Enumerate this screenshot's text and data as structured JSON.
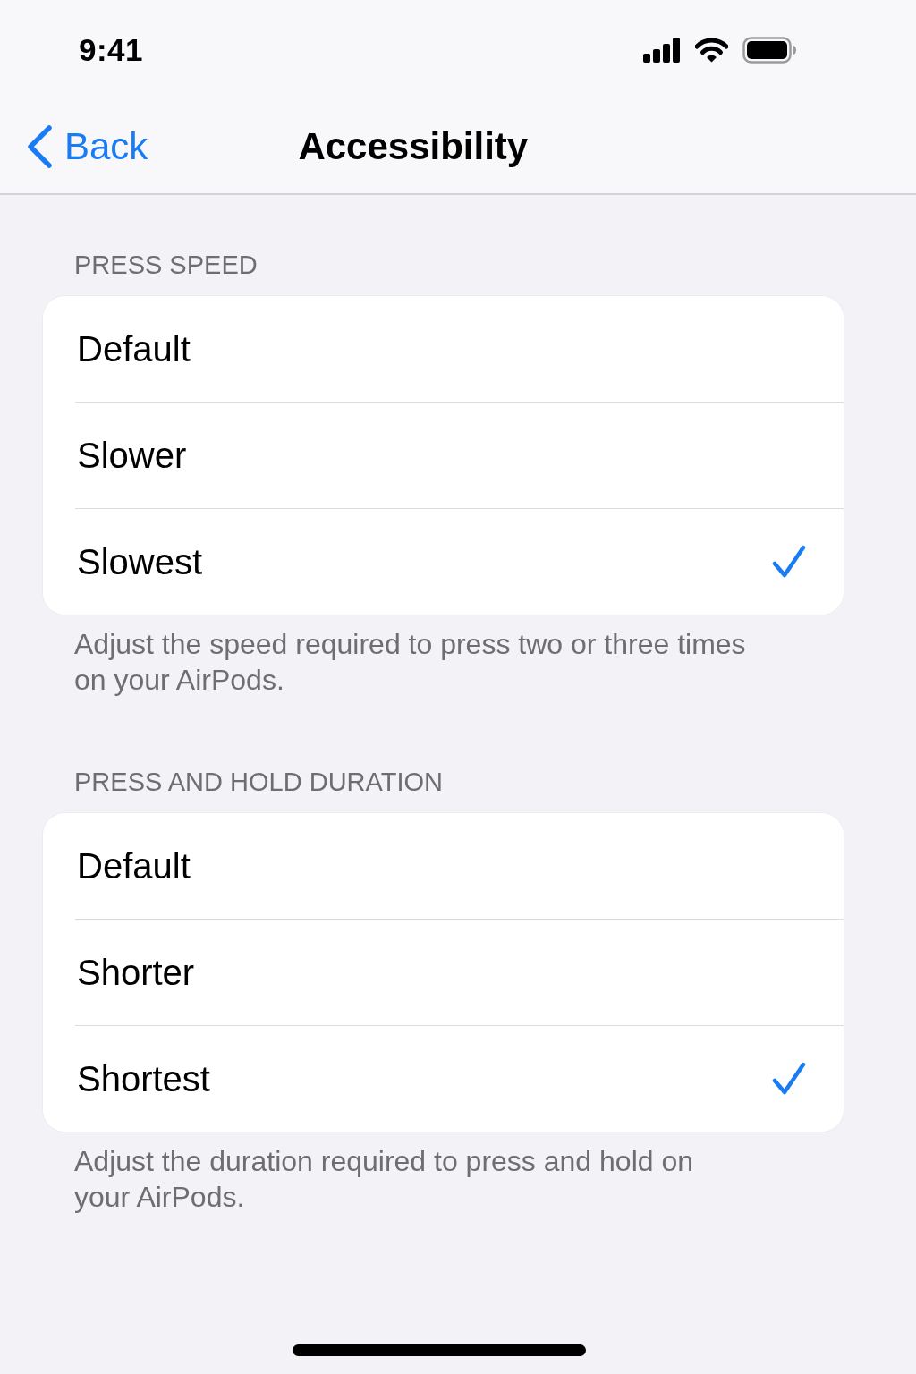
{
  "status_bar": {
    "time": "9:41"
  },
  "nav": {
    "back": "Back",
    "title": "Accessibility"
  },
  "sections": [
    {
      "header": "PRESS SPEED",
      "options": [
        {
          "label": "Default",
          "selected": false
        },
        {
          "label": "Slower",
          "selected": false
        },
        {
          "label": "Slowest",
          "selected": true
        }
      ],
      "footer": "Adjust the speed required to press two or three times on your AirPods."
    },
    {
      "header": "PRESS AND HOLD DURATION",
      "options": [
        {
          "label": "Default",
          "selected": false
        },
        {
          "label": "Shorter",
          "selected": false
        },
        {
          "label": "Shortest",
          "selected": true
        }
      ],
      "footer": "Adjust the duration required to press and hold on your AirPods."
    }
  ]
}
